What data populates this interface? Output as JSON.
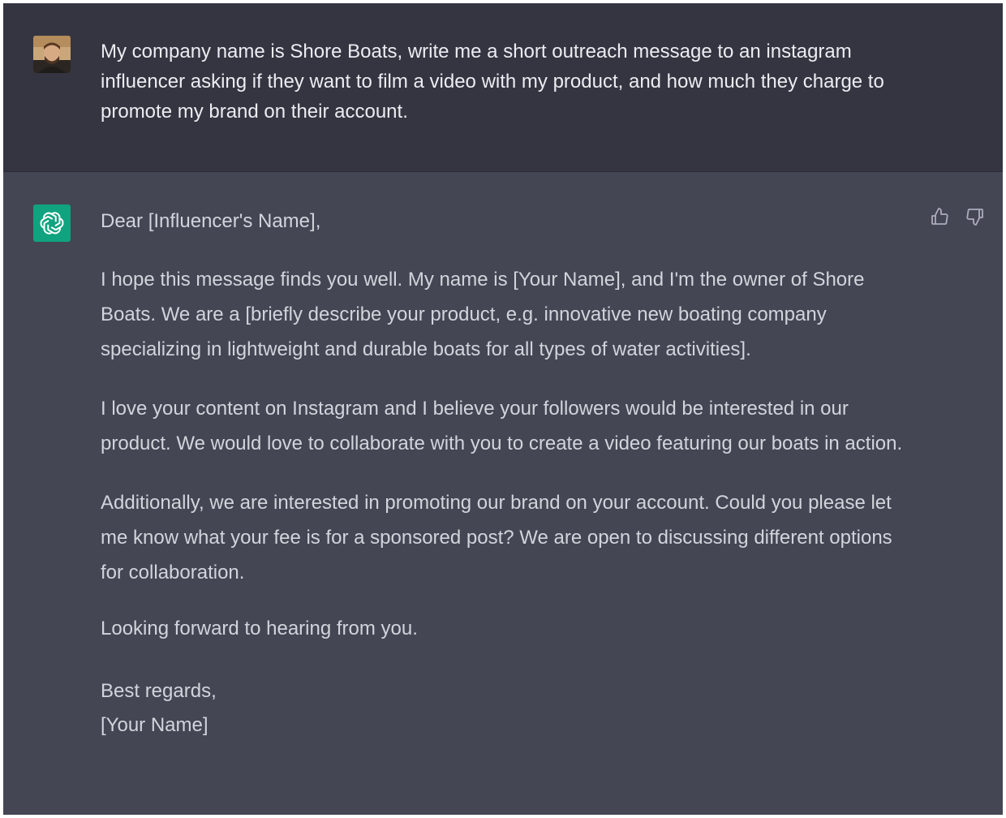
{
  "user_message": {
    "text": "My company name is Shore Boats, write me a short outreach message to an instagram influencer asking if they want to film a video with my product, and how much they charge to promote my brand on their account."
  },
  "assistant_message": {
    "greeting": "Dear [Influencer's Name],",
    "paragraphs": [
      "I hope this message finds you well. My name is [Your Name], and I'm the owner of Shore Boats. We are a [briefly describe your product, e.g. innovative new boating company specializing in lightweight and durable boats for all types of water activities].",
      "I love your content on Instagram and I believe your followers would be interested in our product. We would love to collaborate with you to create a video featuring our boats in action.",
      "Additionally, we are interested in promoting our brand on your account. Could you please let me know what your fee is for a sponsored post? We are open to discussing different options for collaboration."
    ],
    "closing": "Looking forward to hearing from you.",
    "sign_off": "Best regards,",
    "signature": "[Your Name]"
  },
  "icons": {
    "user_avatar": "user-avatar-photo",
    "assistant_avatar": "openai-logo-icon",
    "like": "thumbs-up-icon",
    "dislike": "thumbs-down-icon"
  },
  "colors": {
    "user_bg": "#343541",
    "assistant_bg": "#444654",
    "assistant_avatar_bg": "#10a37f",
    "user_text": "#ececf1",
    "assistant_text": "#d1d5db",
    "icon": "#acacbe"
  }
}
